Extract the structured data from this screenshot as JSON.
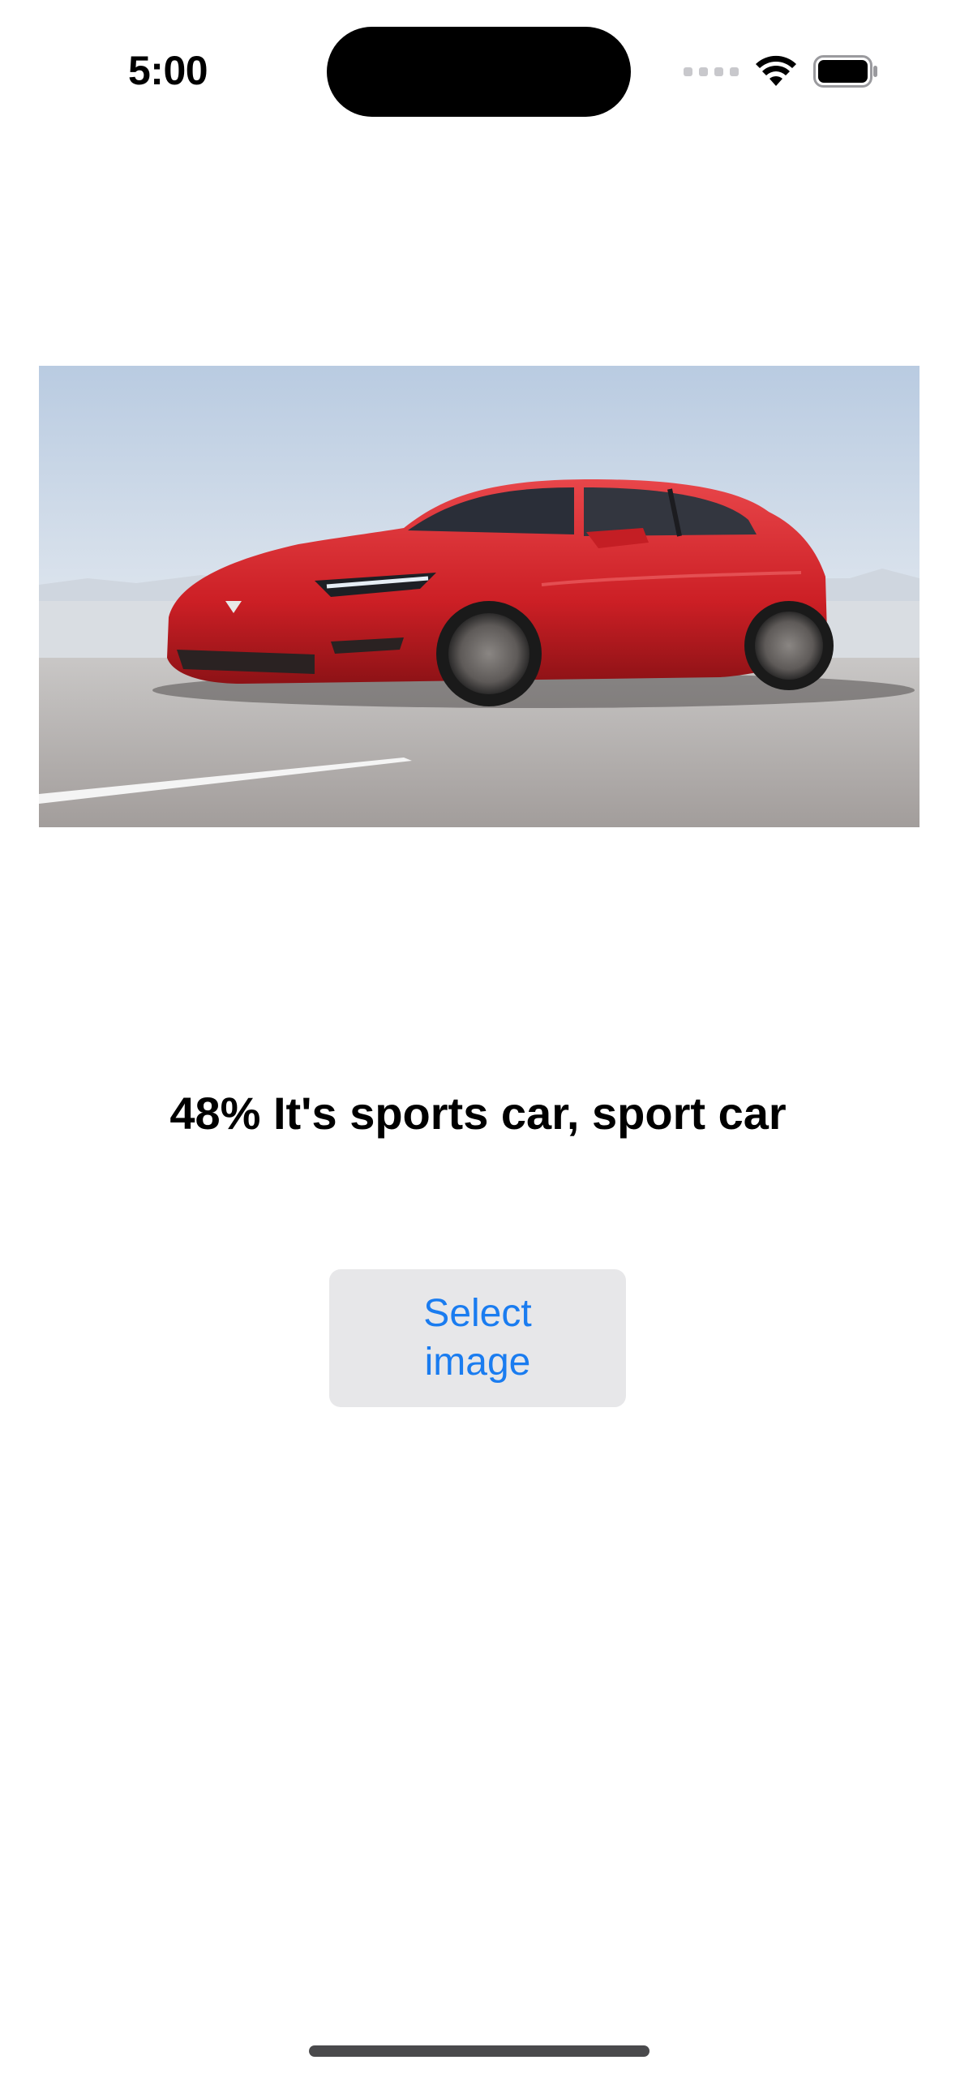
{
  "status_bar": {
    "time": "5:00",
    "icons": [
      "cellular-signal-icon",
      "wifi-icon",
      "battery-icon"
    ]
  },
  "photo": {
    "subject": "red sedan car",
    "icon": "car-photo"
  },
  "result": {
    "text": "48% It's sports car, sport car"
  },
  "actions": {
    "select_image_label": "Select image"
  },
  "colors": {
    "accent": "#1a7cf0",
    "button_bg": "#e7e7e9",
    "car_red": "#d8262b"
  }
}
